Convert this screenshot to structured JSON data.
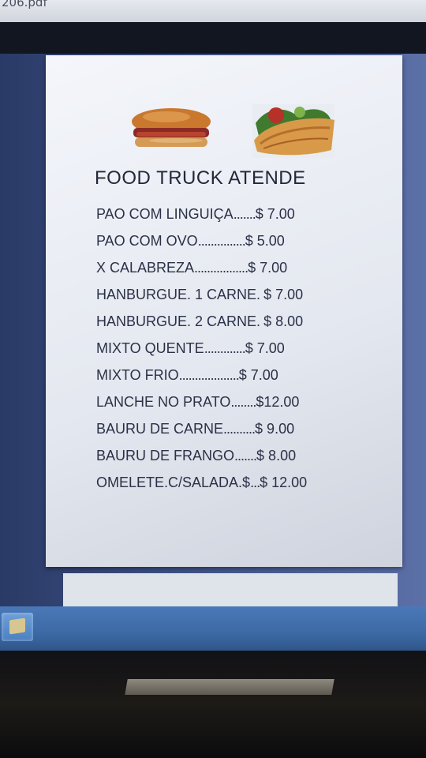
{
  "window": {
    "title": "206.pdf"
  },
  "document": {
    "heading": "FOOD TRUCK ATENDE",
    "items": [
      {
        "name": "PAO COM LINGUIÇA",
        "leader": ".......",
        "price": "$ 7.00"
      },
      {
        "name": "PAO COM OVO",
        "leader": "...............",
        "price": "$ 5.00"
      },
      {
        "name": "X CALABREZA",
        "leader": ".................",
        "price": "$ 7.00"
      },
      {
        "name": "HANBURGUE. 1 CARNE.",
        "leader": " ",
        "price": "$ 7.00"
      },
      {
        "name": "HANBURGUE. 2 CARNE.",
        "leader": " ",
        "price": "$ 8.00"
      },
      {
        "name": "MIXTO QUENTE",
        "leader": ".............",
        "price": "$ 7.00"
      },
      {
        "name": "MIXTO FRIO",
        "leader": "...................",
        "price": "$ 7.00"
      },
      {
        "name": "LANCHE NO PRATO",
        "leader": "........",
        "price": "$12.00"
      },
      {
        "name": "BAURU DE CARNE",
        "leader": "..........",
        "price": "$ 9.00"
      },
      {
        "name": "BAURU DE FRANGO",
        "leader": ".......",
        "price": "$ 8.00"
      },
      {
        "name": "OMELETE.C/SALADA.$",
        "leader": "...",
        "price": "$ 12.00"
      }
    ]
  },
  "icons": {
    "sandwich": "sandwich-image",
    "omelet": "omelet-image",
    "start": "start-button-icon"
  }
}
